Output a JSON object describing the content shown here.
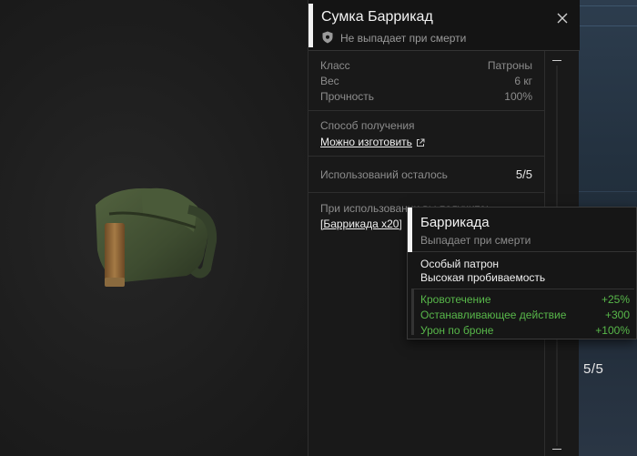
{
  "item": {
    "title": "Сумка Баррикад",
    "subtitle": "Не выпадает при смерти",
    "stats": [
      {
        "label": "Класс",
        "value": "Патроны"
      },
      {
        "label": "Вес",
        "value": "6 кг"
      },
      {
        "label": "Прочность",
        "value": "100%"
      }
    ],
    "obtain_label": "Способ получения",
    "obtain_link": "Можно изготовить",
    "uses_label": "Использований осталось",
    "uses_value": "5/5",
    "reward_label": "При использовании вы получите:",
    "reward_link": "[Баррикада x20]"
  },
  "uses_overlay": "5/5",
  "tooltip": {
    "title": "Баррикада",
    "subtitle": "Выпадает при смерти",
    "desc_line1": "Особый патрон",
    "desc_line2": "Высокая пробиваемость",
    "stats": [
      {
        "label": "Кровотечение",
        "value": "+25%"
      },
      {
        "label": "Останавливающее действие",
        "value": "+300"
      },
      {
        "label": "Урон по броне",
        "value": "+100%"
      }
    ]
  },
  "colors": {
    "accent": "#f2f2f2",
    "positive_stat": "#58b84a",
    "panel_bg": "#191919"
  },
  "icons": [
    "shield-icon",
    "close-icon",
    "external-link-icon"
  ]
}
